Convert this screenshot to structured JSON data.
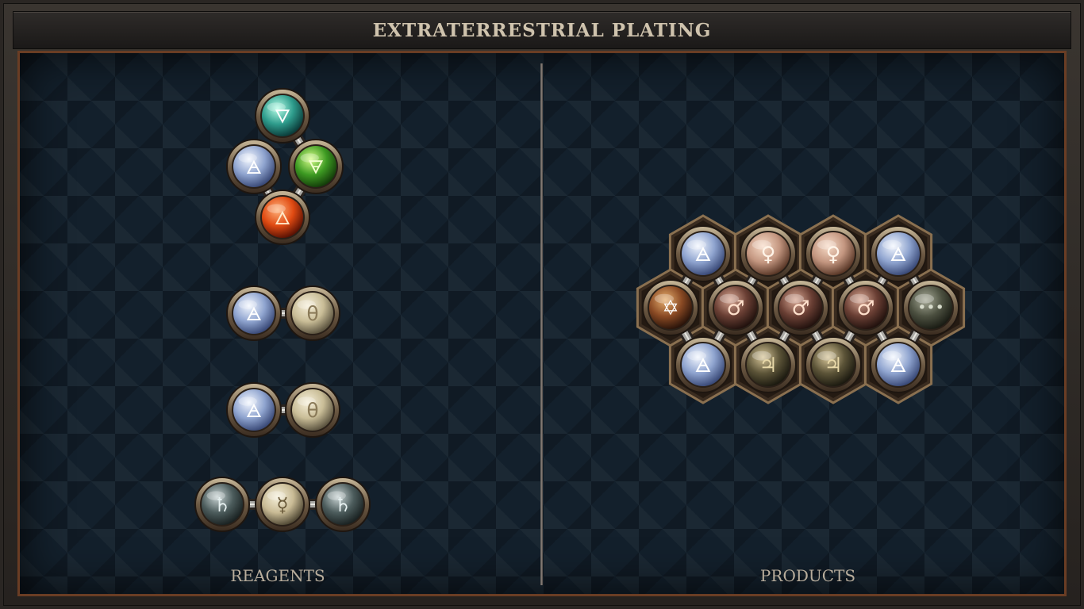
{
  "window": {
    "title": "EXTRATERRESTRIAL PLATING"
  },
  "panels": {
    "reagents_label": "REAGENTS",
    "products_label": "PRODUCTS"
  },
  "palette": {
    "salt": [
      "#f4f8ff",
      "#8fa4cf",
      "#3a4a78"
    ],
    "water": [
      "#b8ffe8",
      "#2e9c8c",
      "#0b3c3a"
    ],
    "earth": [
      "#d8ff8a",
      "#3d9a22",
      "#143d0a"
    ],
    "fire": [
      "#ffb27a",
      "#e04a12",
      "#5a1204"
    ],
    "vitae": [
      "#f6efd9",
      "#c9bd97",
      "#5c5440"
    ],
    "lead": [
      "#c9d4d4",
      "#4c5c5c",
      "#1a2222"
    ],
    "quicksilver": [
      "#f6f1dc",
      "#c9bb95",
      "#524a36"
    ],
    "copper": [
      "#f8dcc8",
      "#c39680",
      "#5a3828"
    ],
    "iron": [
      "#d9a894",
      "#6a3f34",
      "#22120e"
    ],
    "tin": [
      "#d8c79a",
      "#5c5438",
      "#1c1a10"
    ],
    "aether": [
      "#b0b4c0",
      "#5a5a66",
      "#1c1c24"
    ],
    "quintessence": [
      "#e8b070",
      "#8a4a24",
      "#2a140a"
    ],
    "dark": [
      "#a8ab98",
      "#4c5040",
      "#1a1c14"
    ]
  },
  "reagents": [
    {
      "name": "reagent-elements",
      "atoms": [
        {
          "element": "water",
          "glyph": "🜄"
        },
        {
          "element": "salt",
          "glyph": "🜁"
        },
        {
          "element": "earth",
          "glyph": "🜃"
        },
        {
          "element": "fire",
          "glyph": "🜂"
        }
      ],
      "bonds": [
        [
          0,
          2
        ],
        [
          1,
          3
        ],
        [
          2,
          3
        ]
      ]
    },
    {
      "name": "reagent-salt-vitae-1",
      "atoms": [
        {
          "element": "salt",
          "glyph": "🜁"
        },
        {
          "element": "vitae",
          "glyph": "θ"
        }
      ],
      "bonds": [
        [
          0,
          1
        ]
      ]
    },
    {
      "name": "reagent-salt-vitae-2",
      "atoms": [
        {
          "element": "salt",
          "glyph": "🜁"
        },
        {
          "element": "vitae",
          "glyph": "θ"
        }
      ],
      "bonds": [
        [
          0,
          1
        ]
      ]
    },
    {
      "name": "reagent-lead-quicksilver",
      "atoms": [
        {
          "element": "lead",
          "glyph": "♄"
        },
        {
          "element": "quicksilver",
          "glyph": "☿"
        },
        {
          "element": "lead",
          "glyph": "♄"
        }
      ],
      "bonds": [
        [
          0,
          1
        ],
        [
          1,
          2
        ]
      ]
    }
  ],
  "product": {
    "name": "product-extraterrestrial-plating",
    "atoms": [
      {
        "element": "salt",
        "glyph": "🜁"
      },
      {
        "element": "copper",
        "glyph": "♀"
      },
      {
        "element": "copper",
        "glyph": "♀"
      },
      {
        "element": "salt",
        "glyph": "🜁"
      },
      {
        "element": "quintessence",
        "glyph": "✡"
      },
      {
        "element": "iron",
        "glyph": "♂"
      },
      {
        "element": "iron",
        "glyph": "♂"
      },
      {
        "element": "iron",
        "glyph": "♂"
      },
      {
        "element": "dark",
        "glyph": "•••"
      },
      {
        "element": "salt",
        "glyph": "🜁"
      },
      {
        "element": "tin",
        "glyph": "♃"
      },
      {
        "element": "tin",
        "glyph": "♃"
      },
      {
        "element": "salt",
        "glyph": "🜁"
      }
    ],
    "bonds": [
      [
        0,
        4
      ],
      [
        0,
        5
      ],
      [
        1,
        5
      ],
      [
        1,
        6
      ],
      [
        2,
        6
      ],
      [
        2,
        7
      ],
      [
        3,
        7
      ],
      [
        3,
        8
      ],
      [
        4,
        9
      ],
      [
        5,
        9
      ],
      [
        5,
        10
      ],
      [
        6,
        10
      ],
      [
        6,
        11
      ],
      [
        7,
        11
      ],
      [
        7,
        12
      ],
      [
        8,
        12
      ]
    ]
  }
}
